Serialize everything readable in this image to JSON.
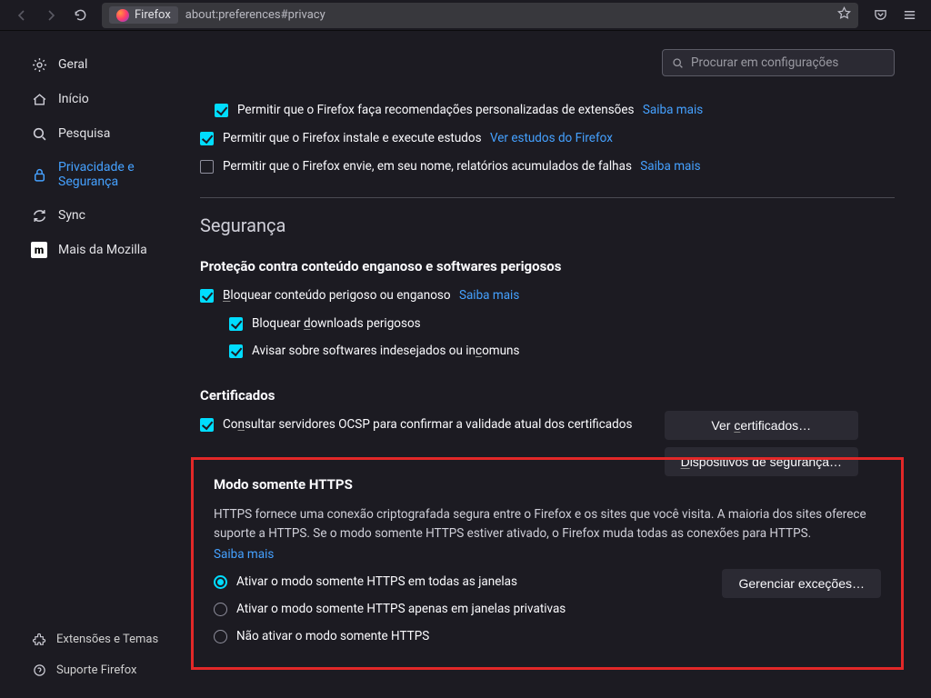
{
  "toolbar": {
    "identity": "Firefox",
    "url": "about:preferences#privacy"
  },
  "search": {
    "placeholder": "Procurar em configurações"
  },
  "sidebar": {
    "items": [
      {
        "label": "Geral"
      },
      {
        "label": "Início"
      },
      {
        "label": "Pesquisa"
      },
      {
        "label": "Privacidade e Segurança"
      },
      {
        "label": "Sync"
      },
      {
        "label": "Mais da Mozilla"
      }
    ],
    "bottom": [
      {
        "label": "Extensões e Temas"
      },
      {
        "label": "Suporte Firefox"
      }
    ]
  },
  "recs": {
    "ext_label": "Permitir que o Firefox faça recomendações personalizadas de extensões",
    "ext_link": "Saiba mais",
    "studies_label": "Permitir que o Firefox instale e execute estudos",
    "studies_link": "Ver estudos do Firefox",
    "crash_label": "Permitir que o Firefox envie, em seu nome, relatórios acumulados de falhas",
    "crash_link": "Saiba mais"
  },
  "security": {
    "heading": "Segurança",
    "deceptive_heading": "Proteção contra conteúdo enganoso e softwares perigosos",
    "block_label_pre": "B",
    "block_label_post": "loquear conteúdo perigoso ou enganoso",
    "block_link": "Saiba mais",
    "downloads_pre": "Bloquear ",
    "downloads_ul": "d",
    "downloads_post": "ownloads perigosos",
    "uncommon_pre": "Avisar sobre softwares indesejados ou in",
    "uncommon_ul": "c",
    "uncommon_post": "omuns"
  },
  "certs": {
    "heading": "Certificados",
    "ocsp_pre": "Co",
    "ocsp_ul": "n",
    "ocsp_post": "sultar servidores OCSP para confirmar a validade atual dos certificados",
    "view_btn_pre": "Ver ",
    "view_btn_ul": "c",
    "view_btn_post": "ertificados…",
    "devices_btn_pre": "D",
    "devices_btn_post": "ispositivos de segurança…"
  },
  "https": {
    "heading": "Modo somente HTTPS",
    "desc": "HTTPS fornece uma conexão criptografada segura entre o Firefox e os sites que você visita. A maioria dos sites oferece suporte a HTTPS. Se o modo somente HTTPS estiver ativado, o Firefox muda todas as conexões para HTTPS.",
    "link": "Saiba mais",
    "opt_all": "Ativar o modo somente HTTPS em todas as janelas",
    "opt_private": "Ativar o modo somente HTTPS apenas em janelas privativas",
    "opt_off": "Não ativar o modo somente HTTPS",
    "manage_btn": "Gerenciar exceções…"
  }
}
